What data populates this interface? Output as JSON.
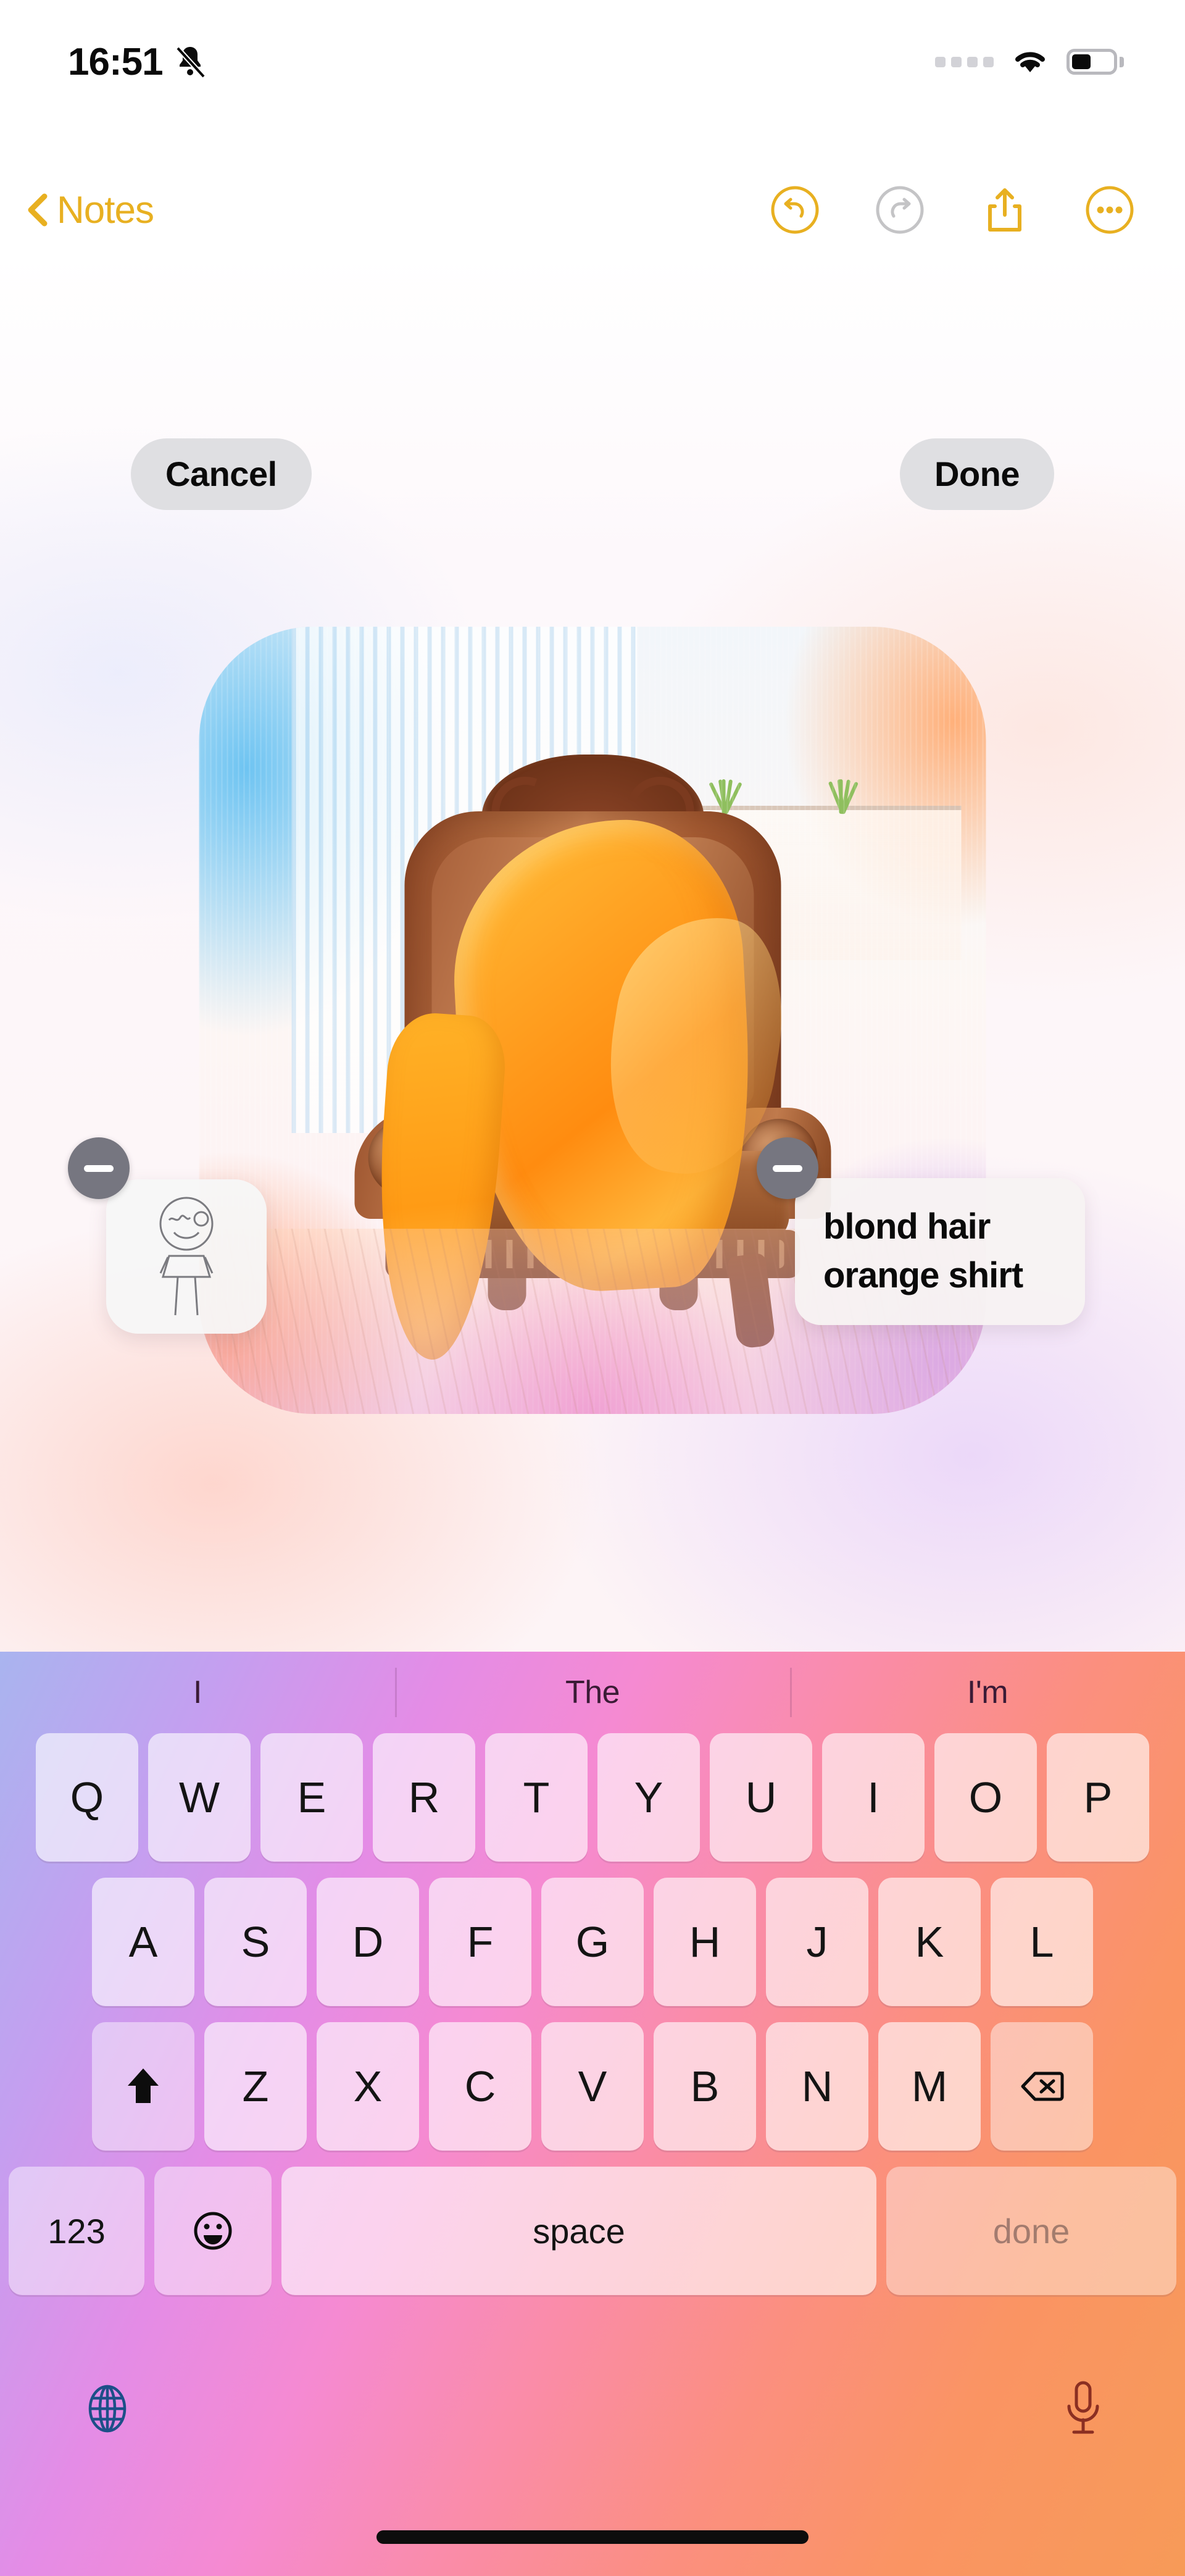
{
  "status_bar": {
    "time": "16:51",
    "silent_icon": "bell-slash-icon",
    "signal_icon": "cellular-signal-icon",
    "wifi_icon": "wifi-icon",
    "battery_icon": "battery-icon",
    "battery_percent": 45
  },
  "nav_bar": {
    "back_label": "Notes",
    "back_icon": "chevron-left-icon",
    "actions": [
      {
        "name": "undo",
        "icon": "undo-circle-icon",
        "enabled": true
      },
      {
        "name": "redo",
        "icon": "redo-circle-icon",
        "enabled": false
      },
      {
        "name": "share",
        "icon": "share-icon",
        "enabled": true
      },
      {
        "name": "more",
        "icon": "more-circle-icon",
        "enabled": true
      }
    ],
    "accent_color": "#e8b021",
    "disabled_color": "#c4c4c6"
  },
  "playground": {
    "cancel_label": "Cancel",
    "done_label": "Done",
    "concepts": [
      {
        "type": "sketch",
        "name": "sketch-chip",
        "remove_icon": "minus-icon"
      },
      {
        "type": "text",
        "line1": "blond hair",
        "line2": "orange shirt",
        "remove_icon": "minus-icon"
      }
    ],
    "image_alt": "Illustration of an ornate carved wooden armchair with an orange blanket draped over it",
    "page_dots": [
      {
        "state": "active"
      },
      {
        "state": "inactive"
      },
      {
        "state": "loading"
      }
    ],
    "feedback": {
      "thumbs_up_icon": "thumbs-up-icon",
      "thumbs_down_icon": "thumbs-down-icon",
      "more_icon": "ellipsis-icon"
    }
  },
  "keyboard": {
    "suggestions": [
      "I",
      "The",
      "I'm"
    ],
    "row1": [
      "Q",
      "W",
      "E",
      "R",
      "T",
      "Y",
      "U",
      "I",
      "O",
      "P"
    ],
    "row2": [
      "A",
      "S",
      "D",
      "F",
      "G",
      "H",
      "J",
      "K",
      "L"
    ],
    "row3": [
      "Z",
      "X",
      "C",
      "V",
      "B",
      "N",
      "M"
    ],
    "shift_icon": "shift-icon",
    "backspace_icon": "backspace-icon",
    "numbers_label": "123",
    "emoji_icon": "emoji-icon",
    "space_label": "space",
    "done_label": "done",
    "globe_icon": "globe-icon",
    "mic_icon": "microphone-icon"
  }
}
